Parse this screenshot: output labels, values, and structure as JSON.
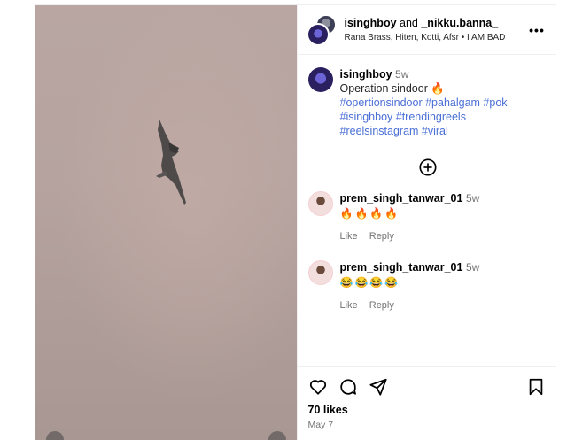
{
  "header": {
    "user1": "isinghboy",
    "joiner": "and",
    "user2": "_nikku.banna_",
    "audio": "Rana Brass, Hiten, Kotti, Afsr • I AM BAD",
    "more_icon": "more-horizontal-icon"
  },
  "caption": {
    "username": "isinghboy",
    "time": "5w",
    "text": "Operation sindoor 🔥",
    "hashtags": "#opertionsindoor #pahalgam #pok #isinghboy #trendingreels #reelsinstagram #viral"
  },
  "load_more_icon": "plus-circle-icon",
  "comments": [
    {
      "username": "prem_singh_tanwar_01",
      "time": "5w",
      "text": "🔥🔥🔥🔥",
      "like": "Like",
      "reply": "Reply"
    },
    {
      "username": "prem_singh_tanwar_01",
      "time": "5w",
      "text": "😂😂😂😂",
      "like": "Like",
      "reply": "Reply"
    }
  ],
  "footer": {
    "likes": "70 likes",
    "date": "May 7",
    "icons": [
      "heart-icon",
      "comment-icon",
      "share-icon",
      "bookmark-icon"
    ]
  },
  "colors": {
    "hashtag": "#4a6fd6",
    "muted": "#737373",
    "media_bg": "#b6a39f"
  }
}
